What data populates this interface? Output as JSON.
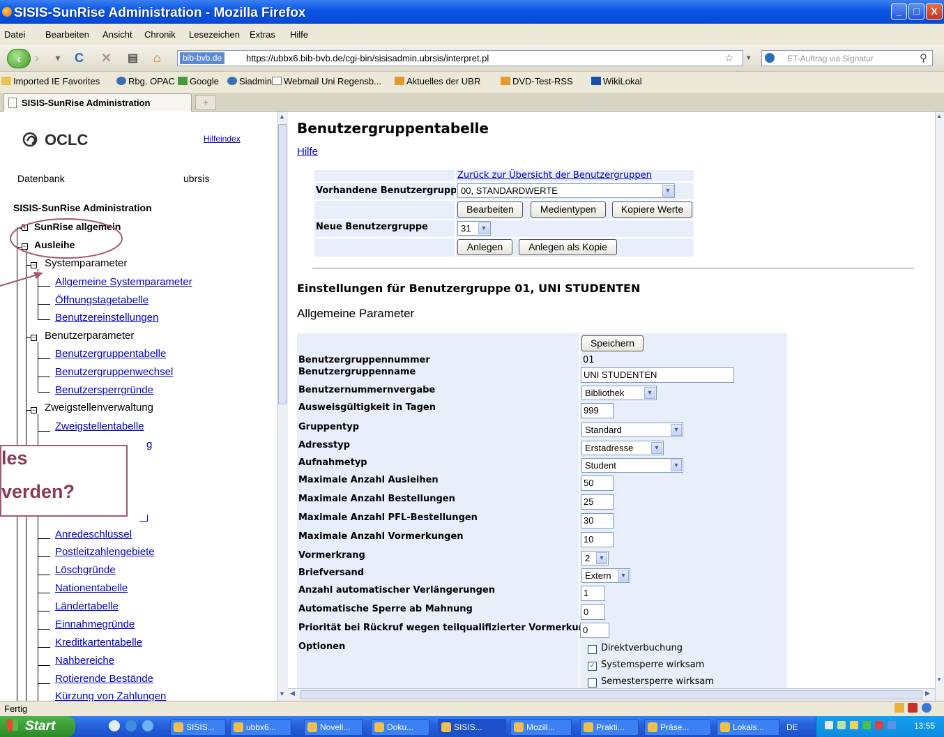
{
  "window": {
    "title": "SISIS-SunRise Administration - Mozilla Firefox",
    "min": "_",
    "max": "□",
    "close": "X"
  },
  "menu": [
    "Datei",
    "Bearbeiten",
    "Ansicht",
    "Chronik",
    "Lesezeichen",
    "Extras",
    "Hilfe"
  ],
  "nav": {
    "site_badge": "bib-bvb.de",
    "url": "https://ubbx6.bib-bvb.de/cgi-bin/sisisadmin.ubrsis/interpret.pl",
    "search_placeholder": "ET-Auftrag via Signatur"
  },
  "bookmarks": [
    "Imported IE Favorites",
    "Rbg. OPAC",
    "Google",
    "Siadmin",
    "Webmail Uni Regensb...",
    "Aktuelles der UBR",
    "DVD-Test-RSS",
    "WikiLokal"
  ],
  "tab": {
    "label": "SISIS-SunRise Administration",
    "new": "+"
  },
  "left": {
    "logo": "OCLC",
    "hilfeindex": "Hilfeindex",
    "db_label": "Datenbank",
    "db_value": "ubrsis",
    "admin_title": "SISIS-SunRise Administration",
    "node_allgemein": "SunRise allgemein",
    "node_ausleihe": "Ausleihe",
    "sys_params": "Systemparameter",
    "links_sys": [
      "Allgemeine Systemparameter",
      "Öffnungstagetabelle",
      "Benutzereinstellungen"
    ],
    "user_params": "Benutzerparameter",
    "links_user": [
      "Benutzergruppentabelle",
      "Benutzergruppenwechsel",
      "Benutzersperrgründe"
    ],
    "branch": "Zweigstellenverwaltung",
    "links_branch": [
      "Zweigstellentabelle",
      "g"
    ],
    "links_misc": [
      "Anredeschlüssel",
      "Postleitzahlengebiete",
      "Löschgründe",
      "Nationentabelle",
      "Ländertabelle",
      "Einnahmegründe",
      "Kreditkartentabelle",
      "Nahbereiche",
      "Rotierende Bestände",
      "Kürzung von Zahlungen"
    ]
  },
  "callout": {
    "line1": "les",
    "line2": "verden?"
  },
  "main": {
    "heading": "Benutzergruppentabelle",
    "hilfe": "Hilfe",
    "back_link": "Zurück zur Übersicht der Benutzergruppen",
    "existing_label": "Vorhandene Benutzergruppe",
    "existing_value": "00, STANDARDWERTE",
    "btn_edit": "Bearbeiten",
    "btn_media": "Medientypen",
    "btn_copy": "Kopiere Werte",
    "new_label": "Neue Benutzergruppe",
    "new_value": "31",
    "btn_create": "Anlegen",
    "btn_create_copy": "Anlegen als Kopie",
    "settings_title": "Einstellungen für Benutzergruppe 01, UNI STUDENTEN",
    "general_params": "Allgemeine Parameter",
    "btn_save": "Speichern",
    "fields": {
      "nr_label": "Benutzergruppennummer",
      "nr_value": "01",
      "name_label": "Benutzergruppenname",
      "name_value": "UNI STUDENTEN",
      "numvergabe_label": "Benutzernummernvergabe",
      "numvergabe_value": "Bibliothek",
      "ausweis_label": "Ausweisgültigkeit in Tagen",
      "ausweis_value": "999",
      "gruppentyp_label": "Gruppentyp",
      "gruppentyp_value": "Standard",
      "adresstyp_label": "Adresstyp",
      "adresstyp_value": "Erstadresse",
      "aufnahme_label": "Aufnahmetyp",
      "aufnahme_value": "Student",
      "max_ausleihen_label": "Maximale Anzahl Ausleihen",
      "max_ausleihen_value": "50",
      "max_best_label": "Maximale Anzahl Bestellungen",
      "max_best_value": "25",
      "max_pfl_label": "Maximale Anzahl PFL-Bestellungen",
      "max_pfl_value": "30",
      "max_vorm_label": "Maximale Anzahl Vormerkungen",
      "max_vorm_value": "10",
      "vormerkrang_label": "Vormerkrang",
      "vormerkrang_value": "2",
      "brief_label": "Briefversand",
      "brief_value": "Extern",
      "verl_label": "Anzahl automatischer Verlängerungen",
      "verl_value": "1",
      "sperre_label": "Automatische Sperre ab Mahnung",
      "sperre_value": "0",
      "prio_label": "Priorität bei Rückruf wegen teilqualifizierter Vormerkung",
      "prio_value": "0",
      "optionen_label": "Optionen",
      "opt1": "Direktverbuchung",
      "opt2": "Systemsperre wirksam",
      "opt3": "Semestersperre wirksam"
    }
  },
  "status": {
    "text": "Fertig"
  },
  "taskbar": {
    "start": "Start",
    "tasks": [
      "SISIS...",
      "ubbx6...",
      "Novell...",
      "Doku...",
      "SISIS...",
      "Mozill...",
      "Prakti...",
      "Präse...",
      "Lokals..."
    ],
    "lang": "DE",
    "time": "13:55"
  }
}
